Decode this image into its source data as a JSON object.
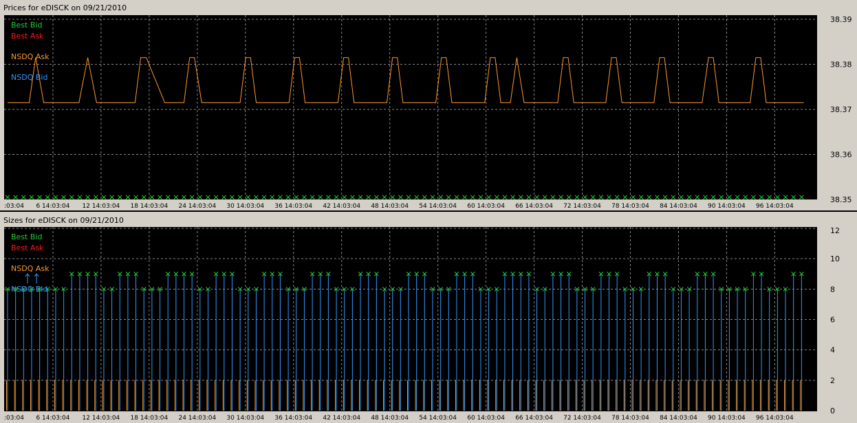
{
  "colors": {
    "best_bid": "#22cc33",
    "best_ask": "#ff1a1a",
    "nsdq_ask": "#ff9a2e",
    "nsdq_bid": "#3399ff",
    "grid": "#8a8a8a",
    "plot_bg": "#000000",
    "frame_bg": "#d4d0c8"
  },
  "chart_data": [
    {
      "type": "line",
      "title": "Prices for  eDISCK  on  09/21/2010",
      "legend_position": "top-left",
      "grid": true,
      "legend": [
        {
          "key": "best_bid",
          "label": "Best Bid"
        },
        {
          "key": "best_ask",
          "label": "Best Ask"
        },
        {
          "key": "nsdq_ask",
          "label": "NSDQ Ask"
        },
        {
          "key": "nsdq_bid",
          "label": "NSDQ Bid"
        }
      ],
      "x_range": [
        0,
        100
      ],
      "xtick_values": [
        0,
        6,
        12,
        18,
        24,
        30,
        36,
        42,
        48,
        54,
        60,
        66,
        72,
        78,
        84,
        90,
        96
      ],
      "xtick_labels": [
        ":03:04",
        "6 14:03:04",
        "12 14:03:04",
        "18 14:03:04",
        "24 14:03:04",
        "30 14:03:04",
        "36 14:03:04",
        "42 14:03:04",
        "48 14:03:04",
        "54 14:03:04",
        "60 14:03:04",
        "66 14:03:04",
        "72 14:03:04",
        "78 14:03:04",
        "84 14:03:04",
        "90 14:03:04",
        "96 14:03:04"
      ],
      "ylim": [
        38.35,
        38.39
      ],
      "ytick_labels": [
        "38.35",
        "38.36",
        "38.37",
        "38.38",
        "38.39"
      ],
      "series": [
        {
          "key": "nsdq_ask",
          "name": "NSDQ Ask",
          "style": "line",
          "x": [
            0,
            2.7,
            3.5,
            4.5,
            8.9,
            10,
            11.1,
            15.9,
            16.6,
            17.3,
            19.6,
            22,
            22.7,
            23,
            23.3,
            24.2,
            29,
            29.7,
            30.3,
            31,
            35.1,
            35.8,
            36.4,
            37.1,
            41.2,
            41.9,
            42.5,
            43.2,
            47.3,
            48,
            48.6,
            49.3,
            53.4,
            54.1,
            54.7,
            55.4,
            59.5,
            60.2,
            60.8,
            61.5,
            62.7,
            63.5,
            64.4,
            68.6,
            69.3,
            69.9,
            70.6,
            74.6,
            75.3,
            75.9,
            76.6,
            80.6,
            81.3,
            81.9,
            82.6,
            86.6,
            87.4,
            88,
            88.7,
            92.6,
            93.3,
            93.9,
            94.6,
            99.3
          ],
          "y": [
            38.3715,
            38.3715,
            38.3815,
            38.3715,
            38.3715,
            38.3815,
            38.3715,
            38.3715,
            38.3815,
            38.3815,
            38.3715,
            38.3715,
            38.3815,
            38.3815,
            38.3815,
            38.3715,
            38.3715,
            38.3815,
            38.3815,
            38.3715,
            38.3715,
            38.3815,
            38.3815,
            38.3715,
            38.3715,
            38.3815,
            38.3815,
            38.3715,
            38.3715,
            38.3815,
            38.3815,
            38.3715,
            38.3715,
            38.3815,
            38.3815,
            38.3715,
            38.3715,
            38.3815,
            38.3815,
            38.3715,
            38.3715,
            38.3815,
            38.3715,
            38.3715,
            38.3815,
            38.3815,
            38.3715,
            38.3715,
            38.3815,
            38.3815,
            38.3715,
            38.3715,
            38.3815,
            38.3815,
            38.3715,
            38.3715,
            38.3815,
            38.3815,
            38.3715,
            38.3715,
            38.3815,
            38.3815,
            38.3715,
            38.3715
          ]
        },
        {
          "key": "best_bid",
          "name": "Best Bid",
          "style": "x-markers",
          "x_start": 0,
          "x_step": 1,
          "count": 100,
          "y_value": 38.3505
        }
      ]
    },
    {
      "type": "bar",
      "title": "Sizes for  eDISCK  on  09/21/2010",
      "legend_position": "top-left",
      "grid": true,
      "legend": [
        {
          "key": "best_bid",
          "label": "Best Bid"
        },
        {
          "key": "best_ask",
          "label": "Best Ask"
        },
        {
          "key": "nsdq_ask",
          "label": "NSDQ Ask"
        },
        {
          "key": "nsdq_bid",
          "label": "NSDQ Bid"
        }
      ],
      "x_range": [
        0,
        100
      ],
      "xtick_values": [
        0,
        6,
        12,
        18,
        24,
        30,
        36,
        42,
        48,
        54,
        60,
        66,
        72,
        78,
        84,
        90,
        96
      ],
      "xtick_labels": [
        ":03:04",
        "6 14:03:04",
        "12 14:03:04",
        "18 14:03:04",
        "24 14:03:04",
        "30 14:03:04",
        "36 14:03:04",
        "42 14:03:04",
        "48 14:03:04",
        "54 14:03:04",
        "60 14:03:04",
        "66 14:03:04",
        "72 14:03:04",
        "78 14:03:04",
        "84 14:03:04",
        "90 14:03:04",
        "96 14:03:04"
      ],
      "ylim": [
        0,
        12
      ],
      "ytick_labels": [
        "0",
        "2",
        "4",
        "6",
        "8",
        "10",
        "12"
      ],
      "x_start": 0,
      "x_step": 1,
      "series": [
        {
          "key": "nsdq_bid",
          "name": "NSDQ Bid",
          "style": "stems",
          "values": [
            8,
            8,
            8,
            8,
            8,
            8,
            8,
            8,
            9,
            9,
            9,
            9,
            8,
            8,
            9,
            9,
            9,
            8,
            8,
            8,
            9,
            9,
            9,
            9,
            8,
            8,
            9,
            9,
            9,
            8,
            8,
            8,
            9,
            9,
            9,
            8,
            8,
            8,
            9,
            9,
            9,
            8,
            8,
            8,
            9,
            9,
            9,
            8,
            8,
            8,
            9,
            9,
            9,
            8,
            8,
            8,
            9,
            9,
            9,
            8,
            8,
            8,
            9,
            9,
            9,
            9,
            8,
            8,
            9,
            9,
            9,
            8,
            8,
            8,
            9,
            9,
            9,
            8,
            8,
            8,
            9,
            9,
            9,
            8,
            8,
            8,
            9,
            9,
            9,
            8,
            8,
            8,
            8,
            9,
            9,
            8,
            8,
            8,
            9,
            9
          ]
        },
        {
          "key": "best_bid",
          "name": "Best Bid",
          "style": "x-markers-on-stems",
          "follows": "nsdq_bid"
        },
        {
          "key": "nsdq_ask",
          "name": "NSDQ Ask",
          "style": "stems",
          "value": 2,
          "count": 100
        }
      ]
    }
  ]
}
